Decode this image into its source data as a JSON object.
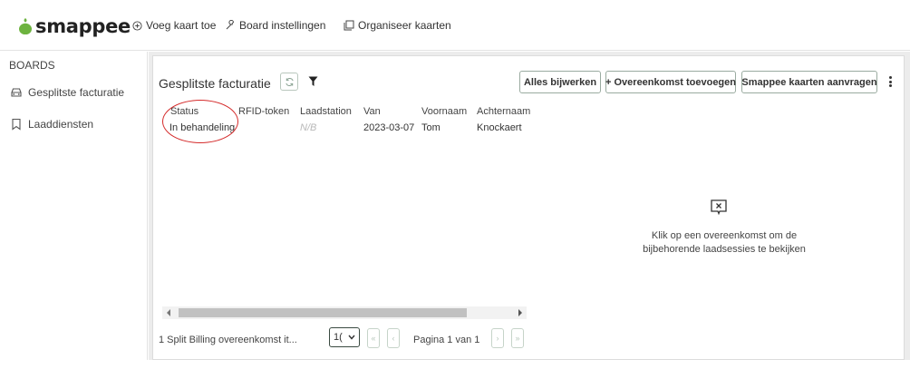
{
  "app": {
    "logo_text": "smappee",
    "brand_color": "#6db33f"
  },
  "topnav": {
    "add_card": "Voeg kaart toe",
    "board_settings": "Board instellingen",
    "organize_cards": "Organiseer kaarten"
  },
  "sidebar": {
    "heading": "BOARDS",
    "items": [
      {
        "label": "Gesplitste facturatie",
        "icon": "car-icon"
      },
      {
        "label": "Laaddiensten",
        "icon": "bookmark-icon"
      }
    ]
  },
  "card": {
    "title": "Gesplitste facturatie",
    "buttons": {
      "update_all": "Alles bijwerken",
      "add_agreement": "+ Overeenkomst toevoegen",
      "request_cards": "Smappee kaarten aanvragen"
    }
  },
  "table": {
    "columns": [
      "Status",
      "RFID-token",
      "Laadstation",
      "Van",
      "Voornaam",
      "Achternaam"
    ],
    "rows": [
      {
        "status": "In behandeling",
        "rfid": "",
        "station": "N/B",
        "from": "2023-03-07",
        "firstname": "Tom",
        "lastname": "Knockaert"
      }
    ],
    "annotation_color": "#d42a2a"
  },
  "pagination": {
    "summary": "1 Split Billing overeenkomst  it...",
    "page_size": "1(",
    "page_info": "Pagina 1 van 1"
  },
  "empty_state": {
    "line1": "Klik op een overeenkomst om de",
    "line2": "bijbehorende laadsessies te bekijken"
  }
}
